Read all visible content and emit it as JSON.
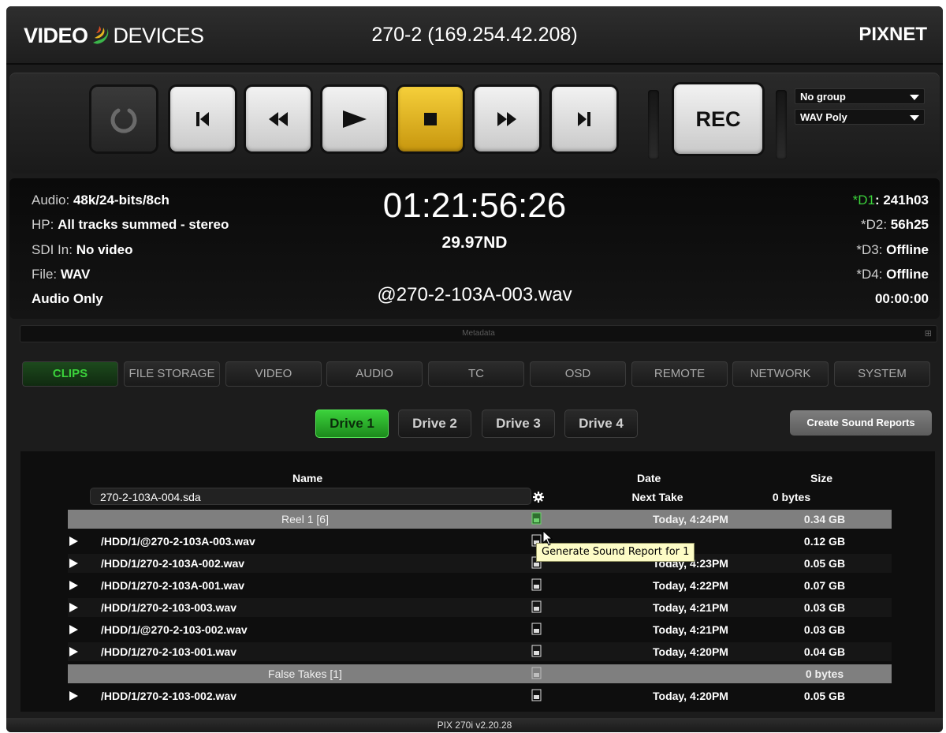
{
  "header": {
    "logo_bold": "VIDEO",
    "logo_light": "DEVICES",
    "title": "270-2 (169.254.42.208)",
    "brand": "PIXNET"
  },
  "transport": {
    "rec_label": "REC",
    "group_select": "No group",
    "format_select": "WAV Poly"
  },
  "status": {
    "audio_key": "Audio: ",
    "audio_val": "48k/24-bits/8ch",
    "hp_key": "HP: ",
    "hp_val": "All tracks summed - stereo",
    "sdi_key": "SDI In: ",
    "sdi_val": "No video",
    "file_key": "File: ",
    "file_val": "WAV",
    "mode": "Audio Only",
    "timecode": "01:21:56:26",
    "framerate": "29.97ND",
    "filename": "@270-2-103A-003.wav",
    "d1_key": "*D1",
    "d1_val": ": 241h03",
    "d2_key": "*D2: ",
    "d2_val": "56h25",
    "d3_key": "*D3: ",
    "d3_val": "Offline",
    "d4_key": "*D4: ",
    "d4_val": "Offline",
    "counter": "00:00:00",
    "metadata_label": "Metadata",
    "accent_green": "#3bd23b"
  },
  "tabs": [
    "CLIPS",
    "FILE STORAGE",
    "VIDEO",
    "AUDIO",
    "TC",
    "OSD",
    "REMOTE",
    "NETWORK",
    "SYSTEM"
  ],
  "drives": [
    "Drive 1",
    "Drive 2",
    "Drive 3",
    "Drive 4"
  ],
  "create_reports": "Create Sound Reports",
  "list": {
    "col_name": "Name",
    "col_date": "Date",
    "col_size": "Size",
    "next_name": "270-2-103A-004.sda",
    "next_date": "Next Take",
    "next_size": "0 bytes",
    "rows": [
      {
        "type": "group",
        "name": "Reel 1 [6]",
        "date": "Today, 4:24PM",
        "size": "0.34 GB"
      },
      {
        "type": "file",
        "name": "/HDD/1/@270-2-103A-003.wav",
        "date": "",
        "size": "0.12 GB"
      },
      {
        "type": "file",
        "name": "/HDD/1/270-2-103A-002.wav",
        "date": "Today, 4:23PM",
        "size": "0.05 GB"
      },
      {
        "type": "file",
        "name": "/HDD/1/270-2-103A-001.wav",
        "date": "Today, 4:22PM",
        "size": "0.07 GB"
      },
      {
        "type": "file",
        "name": "/HDD/1/270-2-103-003.wav",
        "date": "Today, 4:21PM",
        "size": "0.03 GB"
      },
      {
        "type": "file",
        "name": "/HDD/1/@270-2-103-002.wav",
        "date": "Today, 4:21PM",
        "size": "0.03 GB"
      },
      {
        "type": "file",
        "name": "/HDD/1/270-2-103-001.wav",
        "date": "Today, 4:20PM",
        "size": "0.04 GB"
      },
      {
        "type": "group",
        "name": "False Takes [1]",
        "date": "",
        "size": "0 bytes"
      },
      {
        "type": "file",
        "name": "/HDD/1/270-2-103-002.wav",
        "date": "Today, 4:20PM",
        "size": "0.05 GB"
      }
    ],
    "tooltip": "Generate Sound Report for 1"
  },
  "footer": "PIX 270i v2.20.28"
}
